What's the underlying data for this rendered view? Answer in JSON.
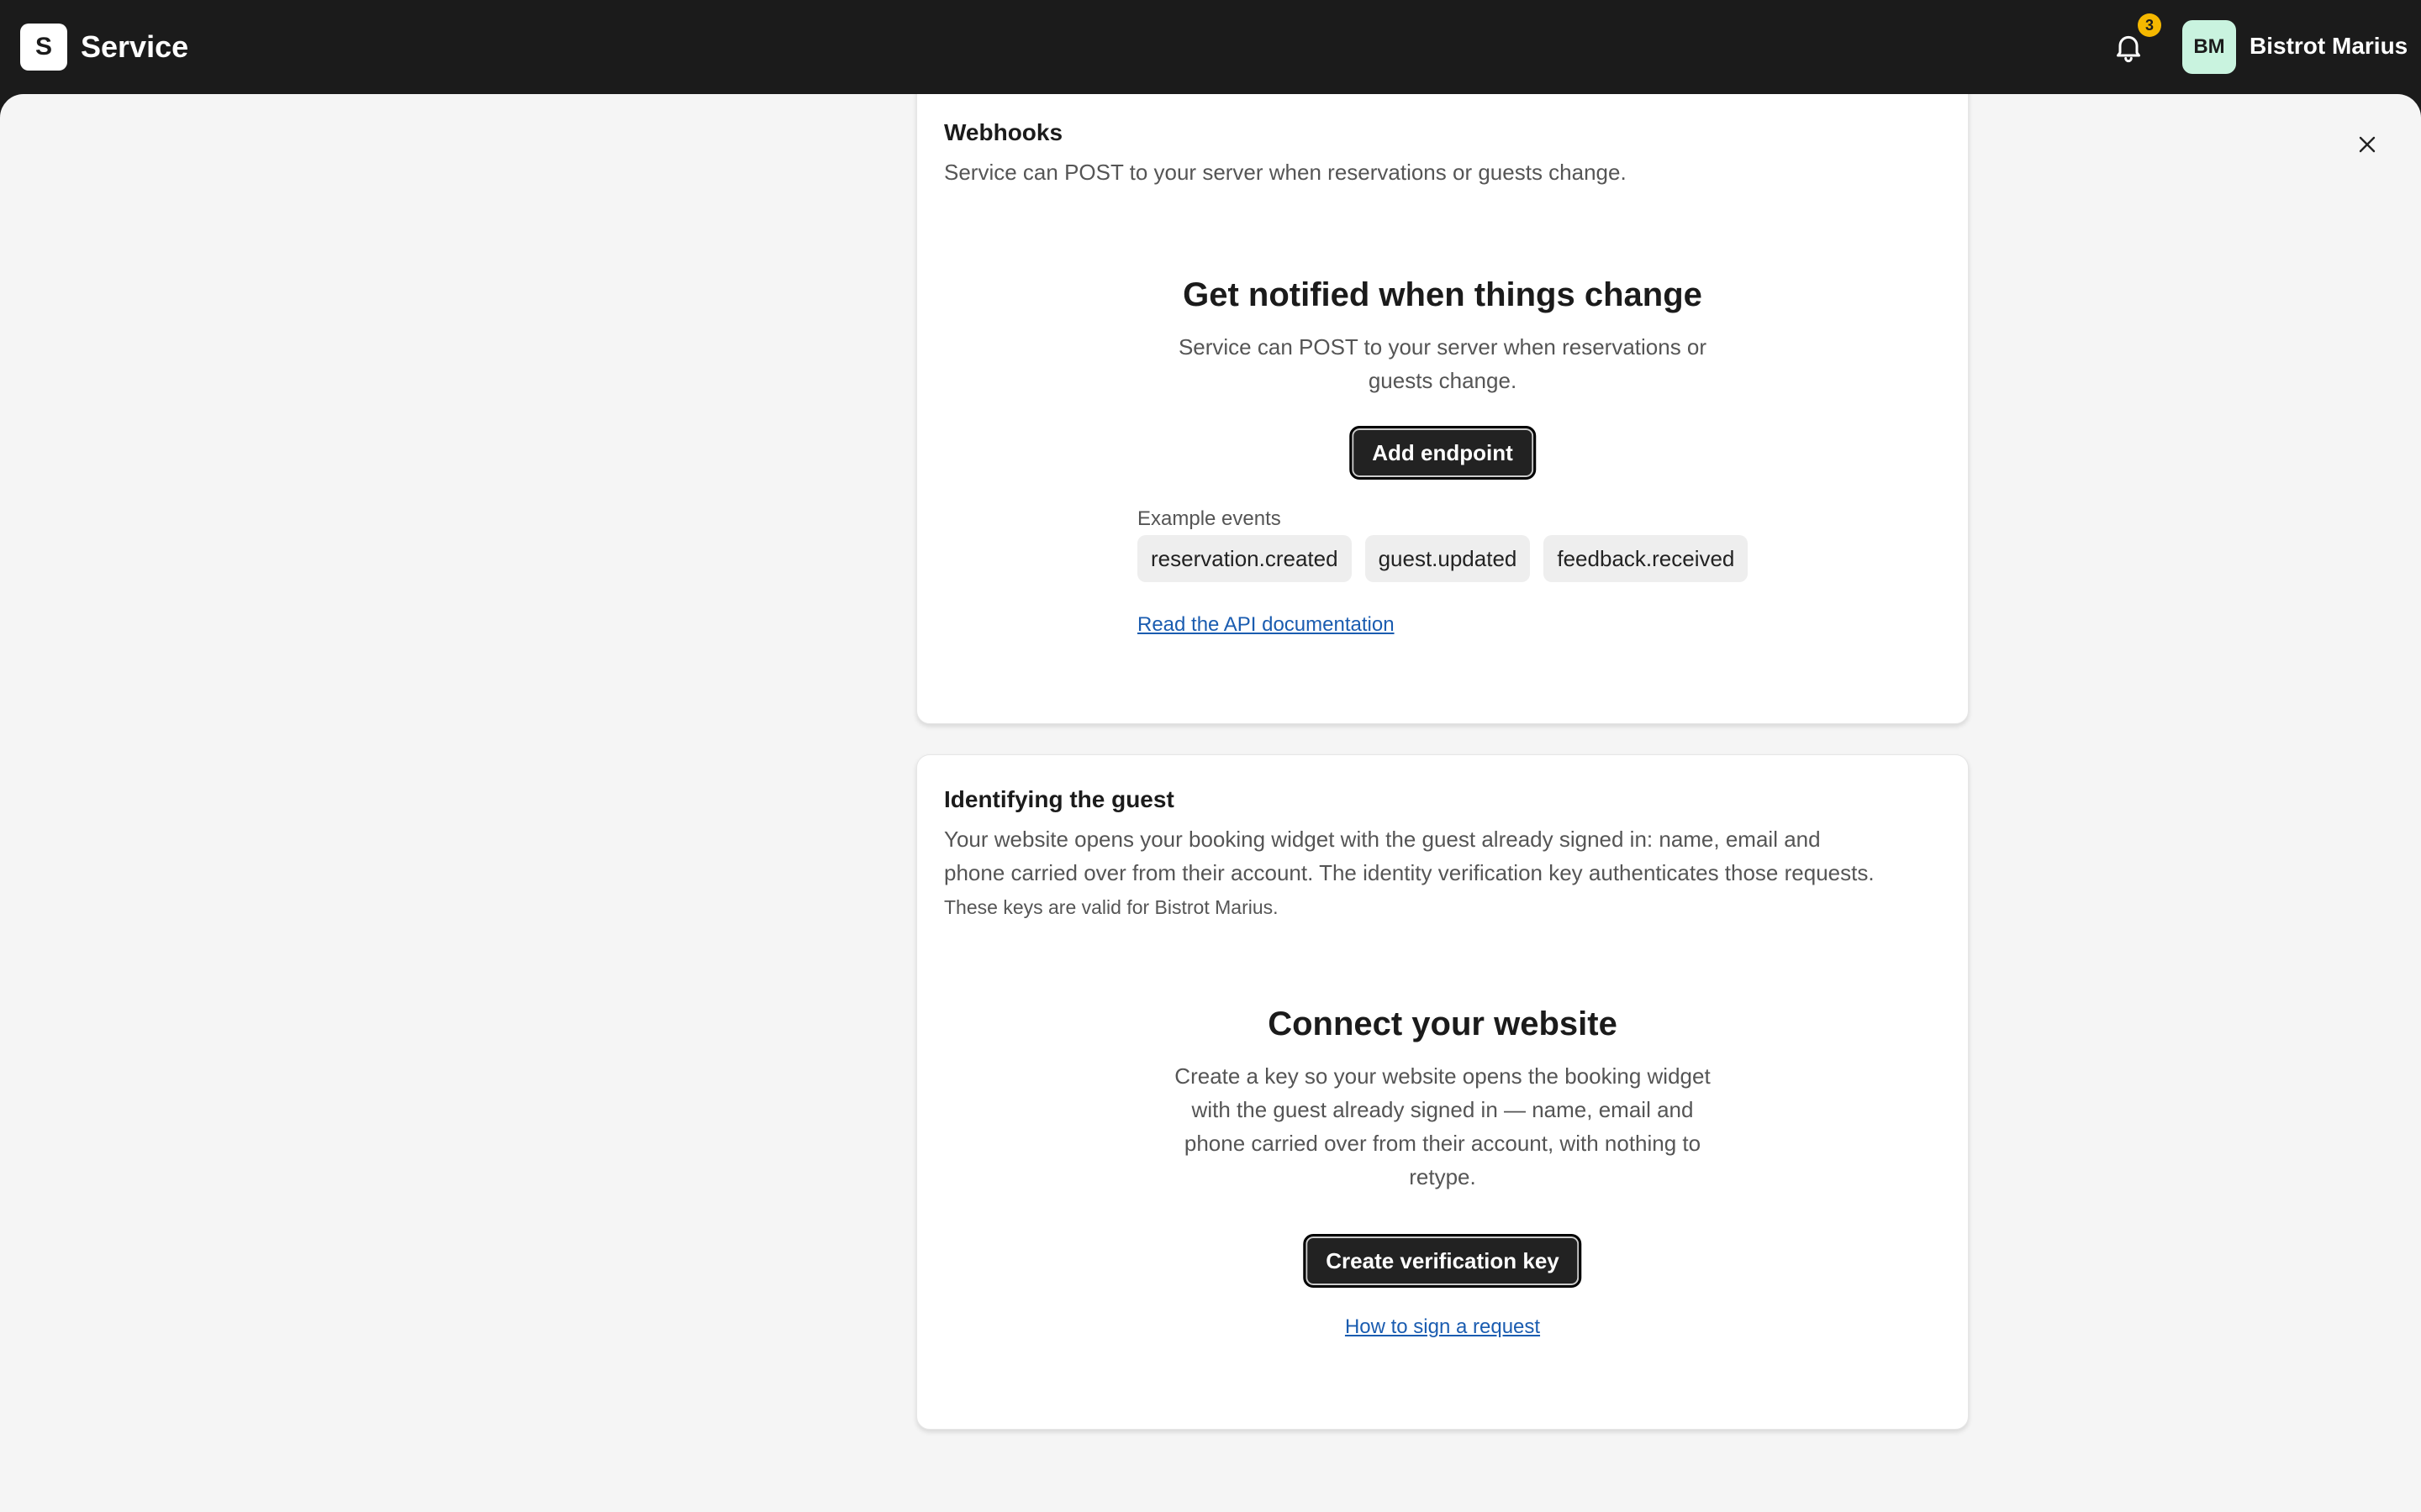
{
  "topbar": {
    "logo_letter": "S",
    "app_name": "Service",
    "notification_count": "3",
    "avatar_initials": "BM",
    "org_name": "Bistrot Marius"
  },
  "icons": {
    "bell": "bell-icon",
    "close": "close-icon"
  },
  "colors": {
    "topbar": "#1b1b1b",
    "badge": "#f5b800",
    "avatar": "#c9f3df",
    "link": "#1a5cb0",
    "button": "#222222"
  },
  "webhooks": {
    "title": "Webhooks",
    "description": "Service can POST to your server when reservations or guests change.",
    "empty_title": "Get notified when things change",
    "empty_description": "Service can POST to your server when reservations or guests change.",
    "add_button": "Add endpoint",
    "examples_label": "Example events",
    "events": [
      "reservation.created",
      "guest.updated",
      "feedback.received"
    ],
    "docs_link": "Read the API documentation"
  },
  "identity": {
    "title": "Identifying the guest",
    "description": "Your website opens your booking widget with the guest already signed in: name, email and phone carried over from their account. The identity verification key authenticates those requests.",
    "note": "These keys are valid for Bistrot Marius.",
    "empty_title": "Connect your website",
    "empty_description": "Create a key so your website opens the booking widget with the guest already signed in — name, email and phone carried over from their account, with nothing to retype.",
    "create_button": "Create verification key",
    "howto_link": "How to sign a request"
  }
}
